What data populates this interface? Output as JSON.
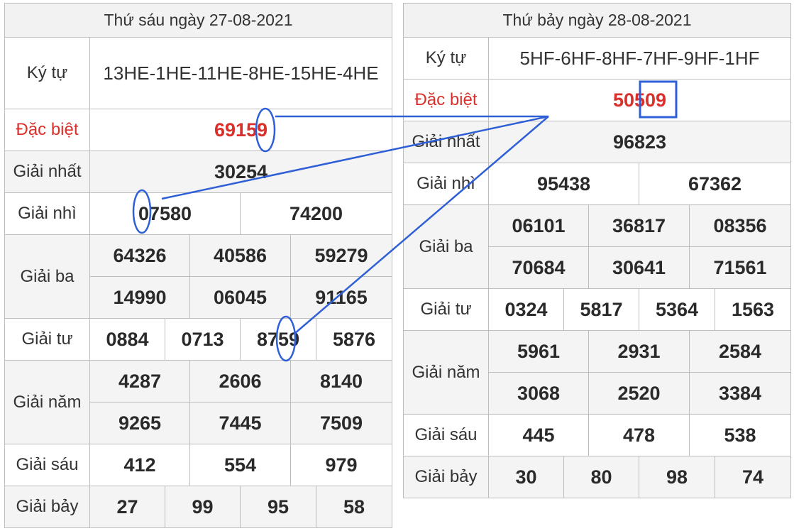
{
  "left": {
    "title": "Thứ sáu ngày 27-08-2021",
    "code_label": "Ký tự",
    "code": "13HE-1HE-11HE-8HE-15HE-4HE",
    "special_label": "Đặc biệt",
    "special": "69159",
    "first_label": "Giải nhất",
    "first": "30254",
    "second_label": "Giải nhì",
    "second": [
      "07580",
      "74200"
    ],
    "third_label": "Giải ba",
    "third": [
      "64326",
      "40586",
      "59279",
      "14990",
      "06045",
      "91165"
    ],
    "fourth_label": "Giải tư",
    "fourth": [
      "0884",
      "0713",
      "8759",
      "5876"
    ],
    "fifth_label": "Giải năm",
    "fifth": [
      "4287",
      "2606",
      "8140",
      "9265",
      "7445",
      "7509"
    ],
    "sixth_label": "Giải sáu",
    "sixth": [
      "412",
      "554",
      "979"
    ],
    "seventh_label": "Giải bảy",
    "seventh": [
      "27",
      "99",
      "95",
      "58"
    ]
  },
  "right": {
    "title": "Thứ bảy ngày 28-08-2021",
    "code_label": "Ký tự",
    "code": "5HF-6HF-8HF-7HF-9HF-1HF",
    "special_label": "Đặc biệt",
    "special": "50509",
    "first_label": "Giải nhất",
    "first": "96823",
    "second_label": "Giải nhì",
    "second": [
      "95438",
      "67362"
    ],
    "third_label": "Giải ba",
    "third": [
      "06101",
      "36817",
      "08356",
      "70684",
      "30641",
      "71561"
    ],
    "fourth_label": "Giải tư",
    "fourth": [
      "0324",
      "5817",
      "5364",
      "1563"
    ],
    "fifth_label": "Giải năm",
    "fifth": [
      "5961",
      "2931",
      "2584",
      "3068",
      "2520",
      "3384"
    ],
    "sixth_label": "Giải sáu",
    "sixth": [
      "445",
      "478",
      "538"
    ],
    "seventh_label": "Giải bảy",
    "seventh": [
      "30",
      "80",
      "98",
      "74"
    ]
  },
  "colors": {
    "special": "#d9302c",
    "annotation": "#2f5fd6"
  }
}
